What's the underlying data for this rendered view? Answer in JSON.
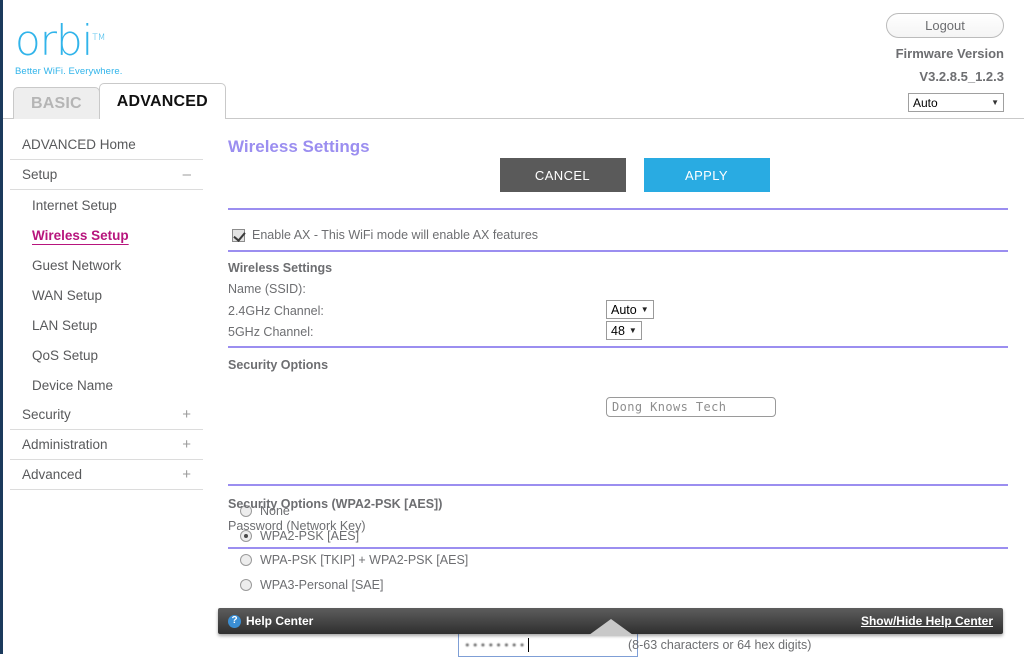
{
  "brand": {
    "logo_text": "orbi",
    "logo_tm": "TM",
    "tagline": "Better WiFi. Everywhere."
  },
  "header": {
    "tabs": [
      {
        "label": "BASIC",
        "active": false
      },
      {
        "label": "ADVANCED",
        "active": true
      }
    ],
    "logout_label": "Logout",
    "firmware_label": "Firmware Version",
    "firmware_version": "V3.2.8.5_1.2.3",
    "language_selected": "Auto"
  },
  "sidebar": {
    "items": [
      {
        "label": "ADVANCED Home",
        "toggle": ""
      },
      {
        "label": "Setup",
        "toggle": "–"
      }
    ],
    "sub_items": [
      {
        "label": "Internet Setup",
        "selected": false
      },
      {
        "label": "Wireless Setup",
        "selected": true
      },
      {
        "label": "Guest Network",
        "selected": false
      },
      {
        "label": "WAN Setup",
        "selected": false
      },
      {
        "label": "LAN Setup",
        "selected": false
      },
      {
        "label": "QoS Setup",
        "selected": false
      },
      {
        "label": "Device Name",
        "selected": false
      }
    ],
    "groups": [
      {
        "label": "Security",
        "toggle": "+"
      },
      {
        "label": "Administration",
        "toggle": "+"
      },
      {
        "label": "Advanced",
        "toggle": "+"
      }
    ]
  },
  "main": {
    "title": "Wireless Settings",
    "cancel_label": "CANCEL",
    "apply_label": "APPLY",
    "enable_ax_label": "Enable AX - This WiFi mode will enable AX features",
    "enable_ax_checked": true,
    "wireless_section_title": "Wireless Settings",
    "ssid_label": "Name (SSID):",
    "ssid_value": "Dong Knows Tech",
    "channel_24_label": "2.4GHz Channel:",
    "channel_24_value": "Auto",
    "channel_5_label": "5GHz Channel:",
    "channel_5_value": "48",
    "security_section_title": "Security Options",
    "security_options": [
      {
        "label": "None",
        "selected": false
      },
      {
        "label": "WPA2-PSK [AES]",
        "selected": true
      },
      {
        "label": "WPA-PSK [TKIP] + WPA2-PSK [AES]",
        "selected": false
      },
      {
        "label": "WPA3-Personal [SAE]",
        "selected": false
      }
    ],
    "password_section_title": "Security Options (WPA2-PSK [AES])",
    "password_label": "Password (Network Key)",
    "password_value": "••••••••",
    "password_hint": "(8-63 characters or 64 hex digits)"
  },
  "footer": {
    "help_center_label": "Help Center",
    "question_icon": "?",
    "show_hide_label": "Show/Hide Help Center"
  },
  "colors": {
    "brand_blue": "#31b4ea",
    "apply_blue": "#29abe2",
    "cancel_gray": "#5a5a5a",
    "accent_purple": "#9b8ef0",
    "selected_magenta": "#b7157d"
  }
}
